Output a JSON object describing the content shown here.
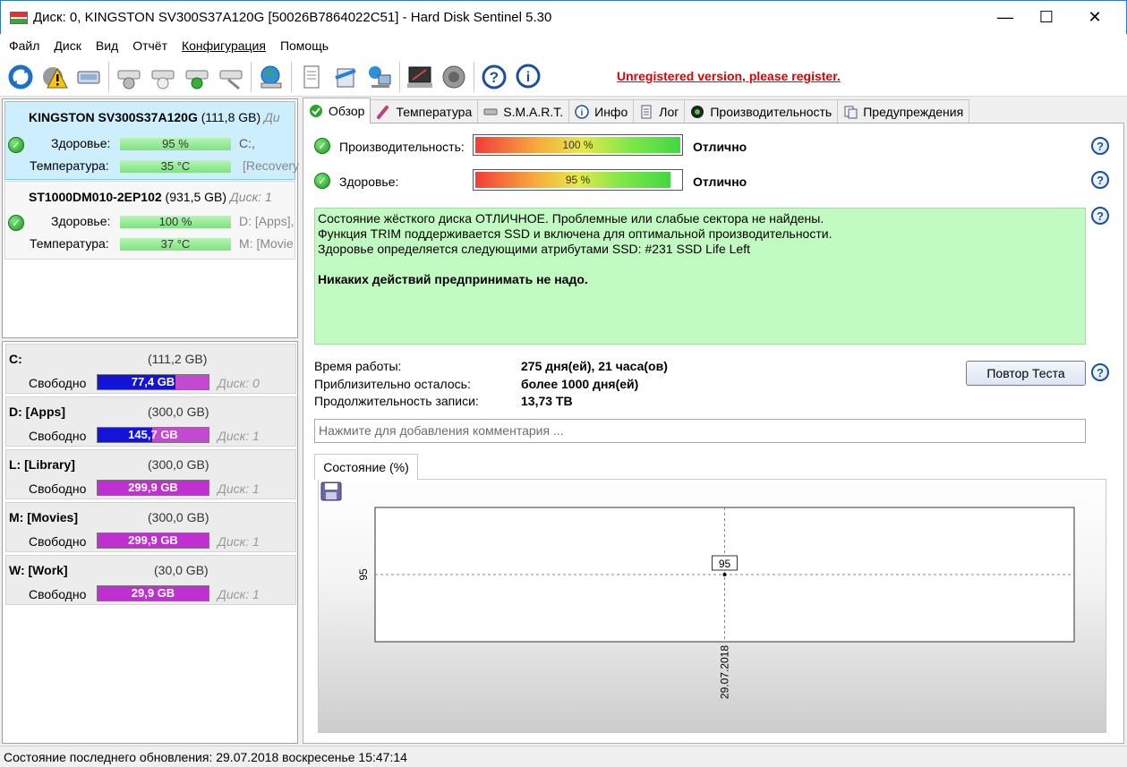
{
  "window": {
    "title": "Диск: 0, KINGSTON SV300S37A120G [50026B7864022C51]  -  Hard Disk Sentinel 5.30",
    "minimize_glyph": "—",
    "maximize_glyph": "☐",
    "close_glyph": "✕"
  },
  "menu": [
    "Файл",
    "Диск",
    "Вид",
    "Отчёт",
    "Конфигурация",
    "Помощь"
  ],
  "toolbar": {
    "icons": [
      "refresh-icon",
      "warning-icon",
      "disk-drive-icon",
      "disk-benchmark-icon",
      "disk-surface-icon",
      "disk-check-icon",
      "disk-wipe-icon",
      "web-icon",
      "report-icon",
      "send-report-icon",
      "network-icon",
      "console-icon",
      "speaker-icon",
      "help-icon",
      "about-icon"
    ],
    "register_text": "Unregistered version, please register."
  },
  "disks": [
    {
      "name": "KINGSTON SV300S37A120G",
      "capacity": "(111,8 GB)",
      "disk_label": "Ди",
      "health_label": "Здоровье:",
      "health_value": "95 %",
      "temp_label": "Температура:",
      "temp_value": "35 °C",
      "side_health": "C:,",
      "side_temp": "[Recovery"
    },
    {
      "name": "ST1000DM010-2EP102",
      "capacity": "(931,5 GB)",
      "disk_label": "Диск: 1",
      "health_label": "Здоровье:",
      "health_value": "100 %",
      "temp_label": "Температура:",
      "temp_value": "37 °C",
      "side_health": "D: [Apps],",
      "side_temp": "M: [Movie"
    }
  ],
  "volumes": [
    {
      "name": "C:",
      "size": "(111,2 GB)",
      "free_label": "Свободно",
      "free_value": "77,4 GB",
      "free_fraction": 0.7,
      "disk": "Диск: 0",
      "bar_color": "#1414d8"
    },
    {
      "name": "D: [Apps]",
      "size": "(300,0 GB)",
      "free_label": "Свободно",
      "free_value": "145,7 GB",
      "free_fraction": 0.49,
      "disk": "Диск: 1",
      "bar_color": "#1414d8"
    },
    {
      "name": "L: [Library]",
      "size": "(300,0 GB)",
      "free_label": "Свободно",
      "free_value": "299,9 GB",
      "free_fraction": 1.0,
      "disk": "Диск: 1",
      "bar_color": "#c030d0"
    },
    {
      "name": "M: [Movies]",
      "size": "(300,0 GB)",
      "free_label": "Свободно",
      "free_value": "299,9 GB",
      "free_fraction": 1.0,
      "disk": "Диск: 1",
      "bar_color": "#c030d0"
    },
    {
      "name": "W: [Work]",
      "size": "(30,0 GB)",
      "free_label": "Свободно",
      "free_value": "29,9 GB",
      "free_fraction": 1.0,
      "disk": "Диск: 1",
      "bar_color": "#c030d0"
    }
  ],
  "tabs": [
    {
      "label": "Обзор",
      "icon": "check-icon",
      "active": true
    },
    {
      "label": "Температура",
      "icon": "thermometer-icon"
    },
    {
      "label": "S.M.A.R.T.",
      "icon": "smart-icon"
    },
    {
      "label": "Инфо",
      "icon": "info-icon"
    },
    {
      "label": "Лог",
      "icon": "log-icon"
    },
    {
      "label": "Производительность",
      "icon": "performance-icon"
    },
    {
      "label": "Предупреждения",
      "icon": "alerts-icon"
    }
  ],
  "overview": {
    "performance_label": "Производительность:",
    "performance_value": "100 %",
    "performance_fraction": 1.0,
    "performance_status": "Отлично",
    "health_label": "Здоровье:",
    "health_value": "95 %",
    "health_fraction": 0.95,
    "health_status": "Отлично",
    "status_lines": [
      "Состояние жёсткого диска ОТЛИЧНОЕ. Проблемные или слабые сектора не найдены.",
      "Функция TRIM поддерживается SSD и включена для оптимальной производительности.",
      "Здоровье определяется следующими атрибутами SSD: #231 SSD Life Left"
    ],
    "status_action": "Никаких действий предпринимать не надо.",
    "uptime_label": "Время работы:",
    "uptime_value": "275 дня(ей), 21 часа(ов)",
    "remaining_label": "Приблизительно осталось:",
    "remaining_value": "более 1000 дня(ей)",
    "written_label": "Продолжительность записи:",
    "written_value": "13,73 TB",
    "retest_button": "Повтор Теста",
    "comment_placeholder": "Нажмите для добавления комментария ..."
  },
  "chart_tab": "Состояние (%)",
  "chart_data": {
    "type": "scatter",
    "x": [
      "29.07.2018"
    ],
    "y": [
      95
    ],
    "ylabel": "",
    "xlabel": "",
    "y_tick_labels": [
      "95"
    ],
    "x_tick_labels": [
      "29.07.2018"
    ],
    "data_labels": [
      "95"
    ],
    "grid": true
  },
  "statusbar": "Состояние последнего обновления: 29.07.2018 воскресенье 15:47:14"
}
